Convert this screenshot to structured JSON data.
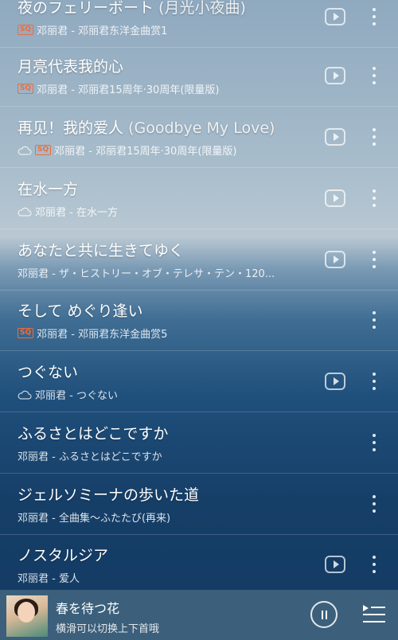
{
  "songs": [
    {
      "title": "夜のフェリーボート",
      "subtitle": " (月光小夜曲)",
      "badge": "SQ",
      "cloud": false,
      "meta": "邓丽君 - 邓丽君东洋金曲赏1",
      "play": true
    },
    {
      "title": "月亮代表我的心",
      "subtitle": "",
      "badge": "SQ",
      "cloud": false,
      "meta": "邓丽君 - 邓丽君15周年·30周年(限量版)",
      "play": true
    },
    {
      "title": "再见！我的爱人",
      "subtitle": " (Goodbye My Love)",
      "badge": "SQ",
      "cloud": true,
      "meta": "邓丽君 - 邓丽君15周年·30周年(限量版)",
      "play": true
    },
    {
      "title": "在水一方",
      "subtitle": "",
      "badge": "",
      "cloud": true,
      "meta": "邓丽君 - 在水一方",
      "play": true
    },
    {
      "title": "あなたと共に生きてゆく",
      "subtitle": "",
      "badge": "",
      "cloud": false,
      "meta": "邓丽君 - ザ・ヒストリー・オブ・テレサ・テン・120...",
      "play": true
    },
    {
      "title": "そして めぐり逢い",
      "subtitle": "",
      "badge": "SQ",
      "cloud": false,
      "meta": "邓丽君 - 邓丽君东洋金曲赏5",
      "play": false
    },
    {
      "title": "つぐない",
      "subtitle": "",
      "badge": "",
      "cloud": true,
      "meta": "邓丽君 - つぐない",
      "play": true
    },
    {
      "title": "ふるさとはどこですか",
      "subtitle": "",
      "badge": "",
      "cloud": false,
      "meta": "邓丽君 - ふるさとはどこですか",
      "play": false
    },
    {
      "title": "ジェルソミーナの歩いた道",
      "subtitle": "",
      "badge": "",
      "cloud": false,
      "meta": "邓丽君 - 全曲集～ふたたび(再来)",
      "play": false
    },
    {
      "title": "ノスタルジア",
      "subtitle": "",
      "badge": "",
      "cloud": false,
      "meta": "邓丽君 - 爱人",
      "play": true
    }
  ],
  "player": {
    "title": "春を待つ花",
    "hint": "横滑可以切换上下首哦"
  }
}
